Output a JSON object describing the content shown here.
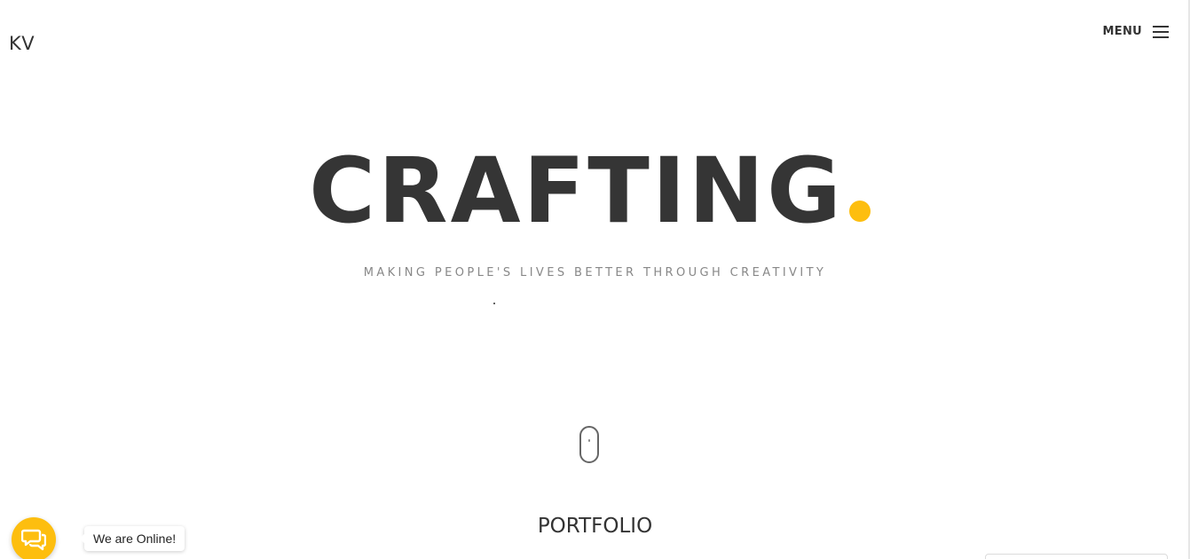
{
  "header": {
    "logo": "KV",
    "menu_label": "MENU",
    "menu_icon": "hamburger-icon"
  },
  "hero": {
    "title": "CRAFTING",
    "accent_dot_color": "#fdbe0f",
    "tagline": "MAKING PEOPLE'S LIVES BETTER THROUGH CREATIVITY"
  },
  "scroll_indicator": {
    "icon": "mouse-scroll-icon"
  },
  "section": {
    "title": "PORTFOLIO"
  },
  "chat": {
    "icon": "chat-bubbles-icon",
    "status_text": "We are Online!",
    "button_color": "#fdbe0f"
  },
  "colors": {
    "text_dark": "#353535",
    "text_muted": "#888888",
    "accent": "#fdbe0f",
    "background": "#ffffff"
  }
}
